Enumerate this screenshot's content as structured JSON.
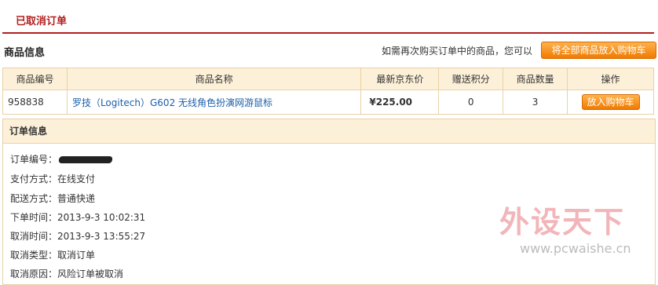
{
  "page": {
    "title": "已取消订单"
  },
  "product_section": {
    "title": "商品信息",
    "hint": "如需再次购买订单中的商品，您可以",
    "add_all_label": "将全部商品放入购物车",
    "columns": [
      "商品编号",
      "商品名称",
      "最新京东价",
      "赠送积分",
      "商品数量",
      "操作"
    ],
    "rows": [
      {
        "id": "958838",
        "name": "罗技（Logitech）G602 无线角色扮演网游鼠标",
        "price": "¥225.00",
        "points": "0",
        "qty": "3",
        "action": "放入购物车"
      }
    ]
  },
  "order_section": {
    "title": "订单信息",
    "fields": [
      {
        "label": "订单编号：",
        "value": ""
      },
      {
        "label": "支付方式：",
        "value": "在线支付"
      },
      {
        "label": "配送方式：",
        "value": "普通快递"
      },
      {
        "label": "下单时间：",
        "value": "2013-9-3 10:02:31"
      },
      {
        "label": "取消时间：",
        "value": "2013-9-3 13:55:27"
      },
      {
        "label": "取消类型：",
        "value": "取消订单"
      },
      {
        "label": "取消原因：",
        "value": "风险订单被取消"
      }
    ]
  },
  "watermark": {
    "text": "外设天下",
    "url": "www.pcwaishe.cn"
  },
  "colors": {
    "accent": "#b21e1e",
    "button": "#f07a00",
    "header_bg": "#fdf0d8",
    "link": "#1c5fa8"
  }
}
